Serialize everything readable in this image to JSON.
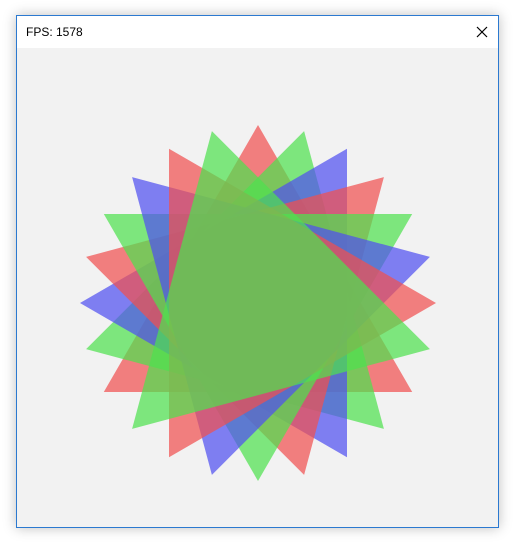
{
  "window": {
    "title": "FPS: 1578",
    "close_icon": "close-icon"
  },
  "scene": {
    "background": "#f2f2f2",
    "colors": {
      "red": "#f05050",
      "green": "#4fe04f",
      "blue": "#5050f0"
    },
    "triangle_count": 8
  }
}
